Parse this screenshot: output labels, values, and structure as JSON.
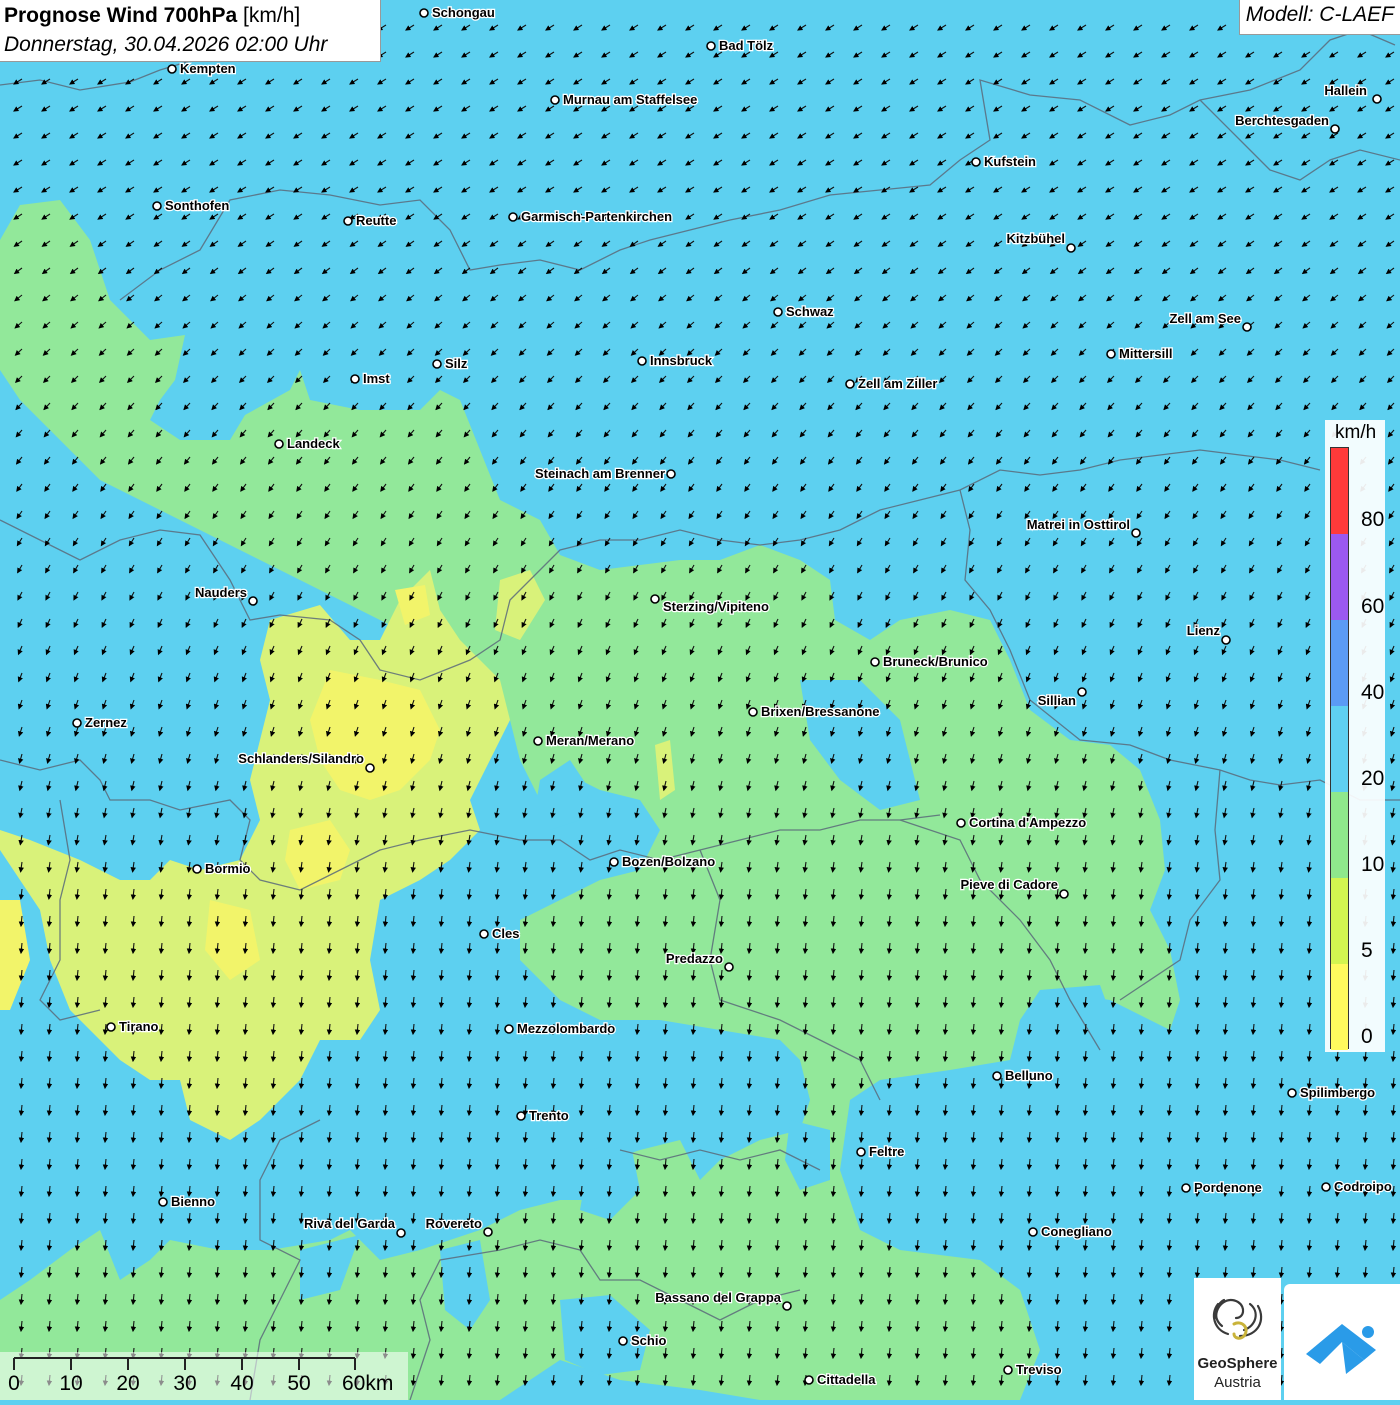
{
  "title": {
    "bold": "Prognose Wind 700hPa",
    "unit": "[km/h]",
    "datetime": "Donnerstag, 30.04.2026 02:00 Uhr"
  },
  "model": "Modell: C-LAEF",
  "legend": {
    "unit": "km/h",
    "labels": [
      "80",
      "60",
      "40",
      "20",
      "10",
      "5",
      "0"
    ],
    "colors": [
      "#ff3a3a",
      "#9b59f0",
      "#5b9bf5",
      "#5fd0f2",
      "#8fe88c",
      "#d3f550",
      "#fffa5e"
    ]
  },
  "scale": {
    "labels": [
      "0",
      "10",
      "20",
      "30",
      "40",
      "50",
      "60km"
    ]
  },
  "logos": {
    "geosphere_name": "GeoSphere",
    "geosphere_sub": "Austria"
  },
  "cities": [
    {
      "name": "Schongau"
    },
    {
      "name": "Kempten"
    },
    {
      "name": "Bad Tölz"
    },
    {
      "name": "Hallein"
    },
    {
      "name": "Murnau am Staffelsee"
    },
    {
      "name": "Berchtesgaden"
    },
    {
      "name": "Kufstein"
    },
    {
      "name": "Sonthofen"
    },
    {
      "name": "Reutte"
    },
    {
      "name": "Garmisch-Partenkirchen"
    },
    {
      "name": "Kitzbühel"
    },
    {
      "name": "Schwaz"
    },
    {
      "name": "Zell am See"
    },
    {
      "name": "Mittersill"
    },
    {
      "name": "Imst"
    },
    {
      "name": "Silz"
    },
    {
      "name": "Innsbruck"
    },
    {
      "name": "Zell am Ziller"
    },
    {
      "name": "Landeck"
    },
    {
      "name": "Steinach am Brenner"
    },
    {
      "name": "Matrei in Osttirol"
    },
    {
      "name": "Nauders"
    },
    {
      "name": "Sterzing/Vipiteno"
    },
    {
      "name": "Lienz"
    },
    {
      "name": "Bruneck/Brunico"
    },
    {
      "name": "Sillian"
    },
    {
      "name": "Zernez"
    },
    {
      "name": "Brixen/Bressanone"
    },
    {
      "name": "Meran/Merano"
    },
    {
      "name": "Schlanders/Silandro"
    },
    {
      "name": "Cortina d'Ampezzo"
    },
    {
      "name": "Bozen/Bolzano"
    },
    {
      "name": "Bormio"
    },
    {
      "name": "Pieve di Cadore"
    },
    {
      "name": "Cles"
    },
    {
      "name": "Predazzo"
    },
    {
      "name": "Tirano"
    },
    {
      "name": "Mezzolombardo"
    },
    {
      "name": "Belluno"
    },
    {
      "name": "Spilimbergo"
    },
    {
      "name": "Trento"
    },
    {
      "name": "Feltre"
    },
    {
      "name": "Bienno"
    },
    {
      "name": "Pordenone"
    },
    {
      "name": "Codroipo"
    },
    {
      "name": "Riva del Garda"
    },
    {
      "name": "Rovereto"
    },
    {
      "name": "Conegliano"
    },
    {
      "name": "Bassano del Grappa"
    },
    {
      "name": "Schio"
    },
    {
      "name": "Treviso"
    },
    {
      "name": "Cittadella"
    }
  ]
}
